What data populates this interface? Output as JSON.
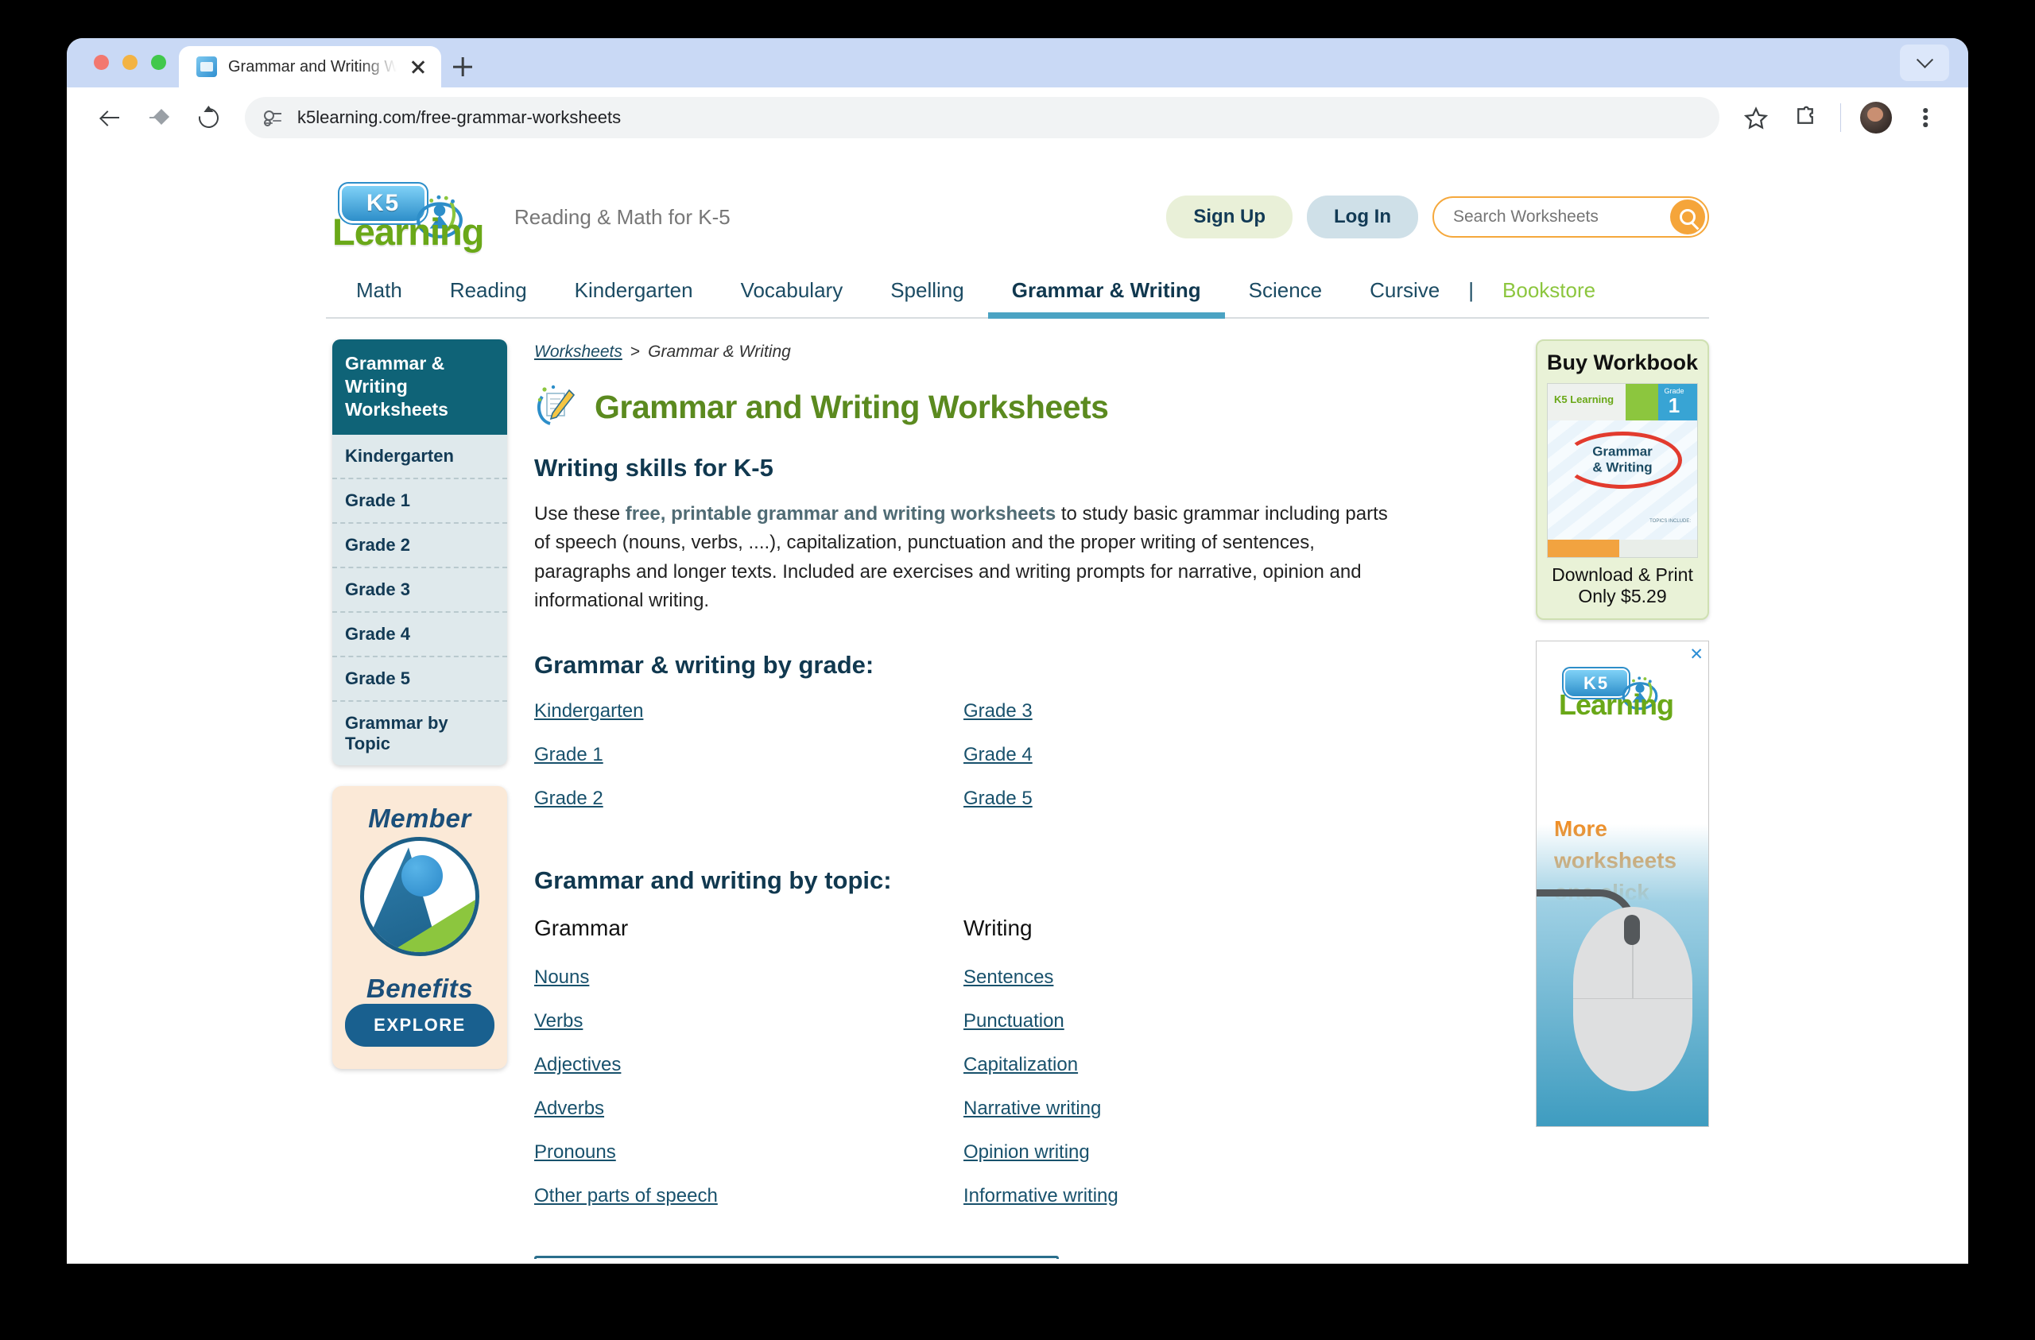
{
  "browser": {
    "tab": {
      "title": "Grammar and Writing Worksh",
      "favicon": "k5-book-icon"
    },
    "url": "k5learning.com/free-grammar-worksheets",
    "new_tab_label": "+",
    "icons": {
      "back": "back-arrow-icon",
      "forward": "forward-arrow-icon",
      "reload": "reload-icon",
      "site_settings": "site-settings-icon",
      "bookmark": "star-icon",
      "extensions": "puzzle-icon",
      "profile": "avatar-icon",
      "menu": "three-dot-menu-icon",
      "tabstrip_chevron": "chevron-down-icon"
    }
  },
  "site": {
    "logo_badge": "K5",
    "logo_word": "Learning",
    "tagline": "Reading & Math for K-5",
    "sign_up": "Sign Up",
    "log_in": "Log In",
    "search_placeholder": "Search Worksheets",
    "search_value": "",
    "search_icon": "magnifier-icon"
  },
  "nav": {
    "items": [
      {
        "label": "Math",
        "active": false,
        "accent": false
      },
      {
        "label": "Reading",
        "active": false,
        "accent": false
      },
      {
        "label": "Kindergarten",
        "active": false,
        "accent": false
      },
      {
        "label": "Vocabulary",
        "active": false,
        "accent": false
      },
      {
        "label": "Spelling",
        "active": false,
        "accent": false
      },
      {
        "label": "Grammar & Writing",
        "active": true,
        "accent": false
      },
      {
        "label": "Science",
        "active": false,
        "accent": false
      },
      {
        "label": "Cursive",
        "active": false,
        "accent": false
      }
    ],
    "separator": "|",
    "bookstore": "Bookstore"
  },
  "sidebar": {
    "heading": "Grammar & Writing Worksheets",
    "items": [
      {
        "label": "Kindergarten"
      },
      {
        "label": "Grade 1"
      },
      {
        "label": "Grade 2"
      },
      {
        "label": "Grade 3"
      },
      {
        "label": "Grade 4"
      },
      {
        "label": "Grade 5"
      },
      {
        "label": "Grammar by Topic"
      }
    ]
  },
  "member_card": {
    "text_top": "Member",
    "text_bottom": "Benefits",
    "button": "EXPLORE"
  },
  "breadcrumb": {
    "root": "Worksheets",
    "separator": ">",
    "current": "Grammar & Writing"
  },
  "main": {
    "title": "Grammar and Writing Worksheets",
    "title_icon": "pencil-paper-icon",
    "subheading": "Writing skills for K-5",
    "intro_before": "Use these ",
    "intro_bold": "free, printable grammar and writing worksheets",
    "intro_after": " to study basic grammar including parts of speech (nouns, verbs, ....), capitalization, punctuation and the proper writing of sentences, paragraphs and longer texts. Included are exercises and writing prompts for narrative, opinion and informational writing.",
    "grade_heading": "Grammar & writing by grade:",
    "grade_links_left": [
      "Kindergarten",
      "Grade 1",
      "Grade 2"
    ],
    "grade_links_right": [
      "Grade 3",
      "Grade 4",
      "Grade 5"
    ],
    "topic_heading": "Grammar and writing by topic:",
    "topic_col1_head": "Grammar",
    "topic_col2_head": "Writing",
    "topic_col1": [
      "Nouns",
      "Verbs",
      "Adjectives",
      "Adverbs",
      "Pronouns",
      "Other parts of speech"
    ],
    "topic_col2": [
      "Sentences",
      "Punctuation",
      "Capitalization",
      "Narrative writing",
      "Opinion writing",
      "Informative writing"
    ]
  },
  "buy_card": {
    "title": "Buy Workbook",
    "cover_brand": "K5 Learning",
    "cover_grade_label": "Grade",
    "cover_grade_number": "1",
    "cover_title_line1": "Grammar",
    "cover_title_line2": "& Writing",
    "cover_topics": "TOPICS INCLUDE:",
    "sub_line1": "Download & Print",
    "sub_line2": "Only $5.29"
  },
  "ad": {
    "close_icon": "close-icon",
    "logo_badge": "K5",
    "logo_word": "Learning",
    "headline": "More worksheets one click away.",
    "image": "computer-mouse-illustration"
  }
}
